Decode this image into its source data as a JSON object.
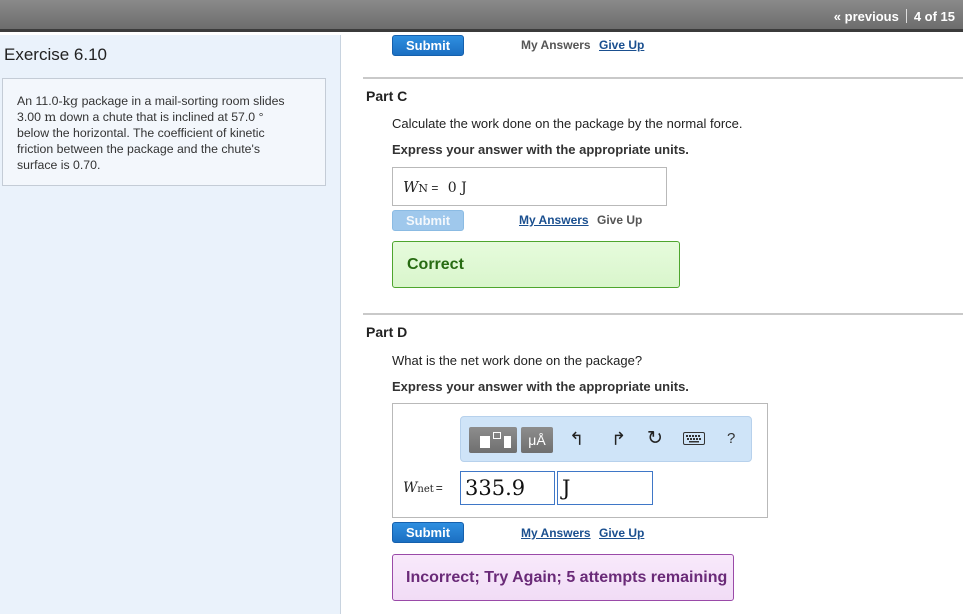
{
  "header": {
    "previous_label": "« previous",
    "page_indicator": "4 of 15"
  },
  "exercise": {
    "title": "Exercise 6.10",
    "problem": {
      "p1": "An 11.0-",
      "u_kg": "kg",
      "p2": " package in a mail-sorting room slides",
      "p3": "3.00 ",
      "u_m": "m",
      "p4": " down a chute that is inclined at 57.0 °",
      "p5": "below the horizontal. The coefficient of kinetic",
      "p6": "friction between the package and the chute's",
      "p7": "surface is 0.70."
    }
  },
  "top_controls": {
    "submit_label": "Submit",
    "my_answers_label": "My Answers",
    "give_up_label": "Give Up"
  },
  "part_c": {
    "title": "Part C",
    "question": "Calculate the work done on the package by the normal force.",
    "instruction": "Express your answer with the appropriate units.",
    "answer_var": "W",
    "answer_sub": "N",
    "answer_eq": " = ",
    "answer_value": "0 J",
    "submit_label": "Submit",
    "my_answers_label": "My Answers",
    "give_up_label": "Give Up",
    "feedback": "Correct"
  },
  "part_d": {
    "title": "Part D",
    "question": "What is the net work done on the package?",
    "instruction": "Express your answer with the appropriate units.",
    "toolbar": {
      "units_label": "μÅ",
      "help_label": "?"
    },
    "answer_var": "W",
    "answer_sub": "net",
    "answer_eq": "=",
    "value_input": "335.9",
    "unit_input": "J",
    "submit_label": "Submit",
    "my_answers_label": "My Answers",
    "give_up_label": "Give Up",
    "feedback": "Incorrect; Try Again; 5 attempts remaining"
  },
  "colors": {
    "accent": "#1b6fc2",
    "correct_border": "#4ea52e",
    "incorrect_border": "#9a4aa8"
  }
}
